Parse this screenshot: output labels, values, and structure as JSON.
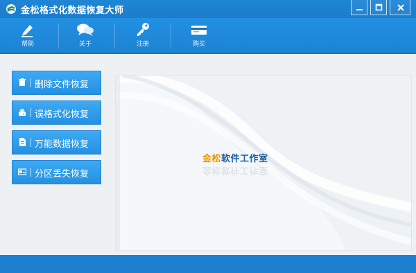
{
  "app": {
    "title": "金松格式化数据恢复大师",
    "logo_icon": "app-logo-icon"
  },
  "window_controls": {
    "minimize_icon": "minimize-icon",
    "maximize_icon": "maximize-icon",
    "close_icon": "close-icon"
  },
  "toolbar": {
    "help": {
      "label": "帮助",
      "icon": "pencil-icon"
    },
    "about": {
      "label": "关于",
      "icon": "chat-icon"
    },
    "register": {
      "label": "注册",
      "icon": "key-icon"
    },
    "buy": {
      "label": "购买",
      "icon": "card-icon"
    }
  },
  "sidebar": {
    "items": [
      {
        "label": "删除文件恢复",
        "icon": "trash-icon"
      },
      {
        "label": "误格式化恢复",
        "icon": "drive-icon"
      },
      {
        "label": "万能数据恢复",
        "icon": "document-icon"
      },
      {
        "label": "分区丢失恢复",
        "icon": "partition-icon"
      }
    ]
  },
  "branding": {
    "part1": "金松",
    "part2": "软件工作室"
  },
  "colors": {
    "titlebar": "#1f86d6",
    "toolbar": "#2290e2",
    "button": "#2490e2",
    "brand_orange": "#e89400",
    "brand_blue": "#1b5d9c"
  }
}
